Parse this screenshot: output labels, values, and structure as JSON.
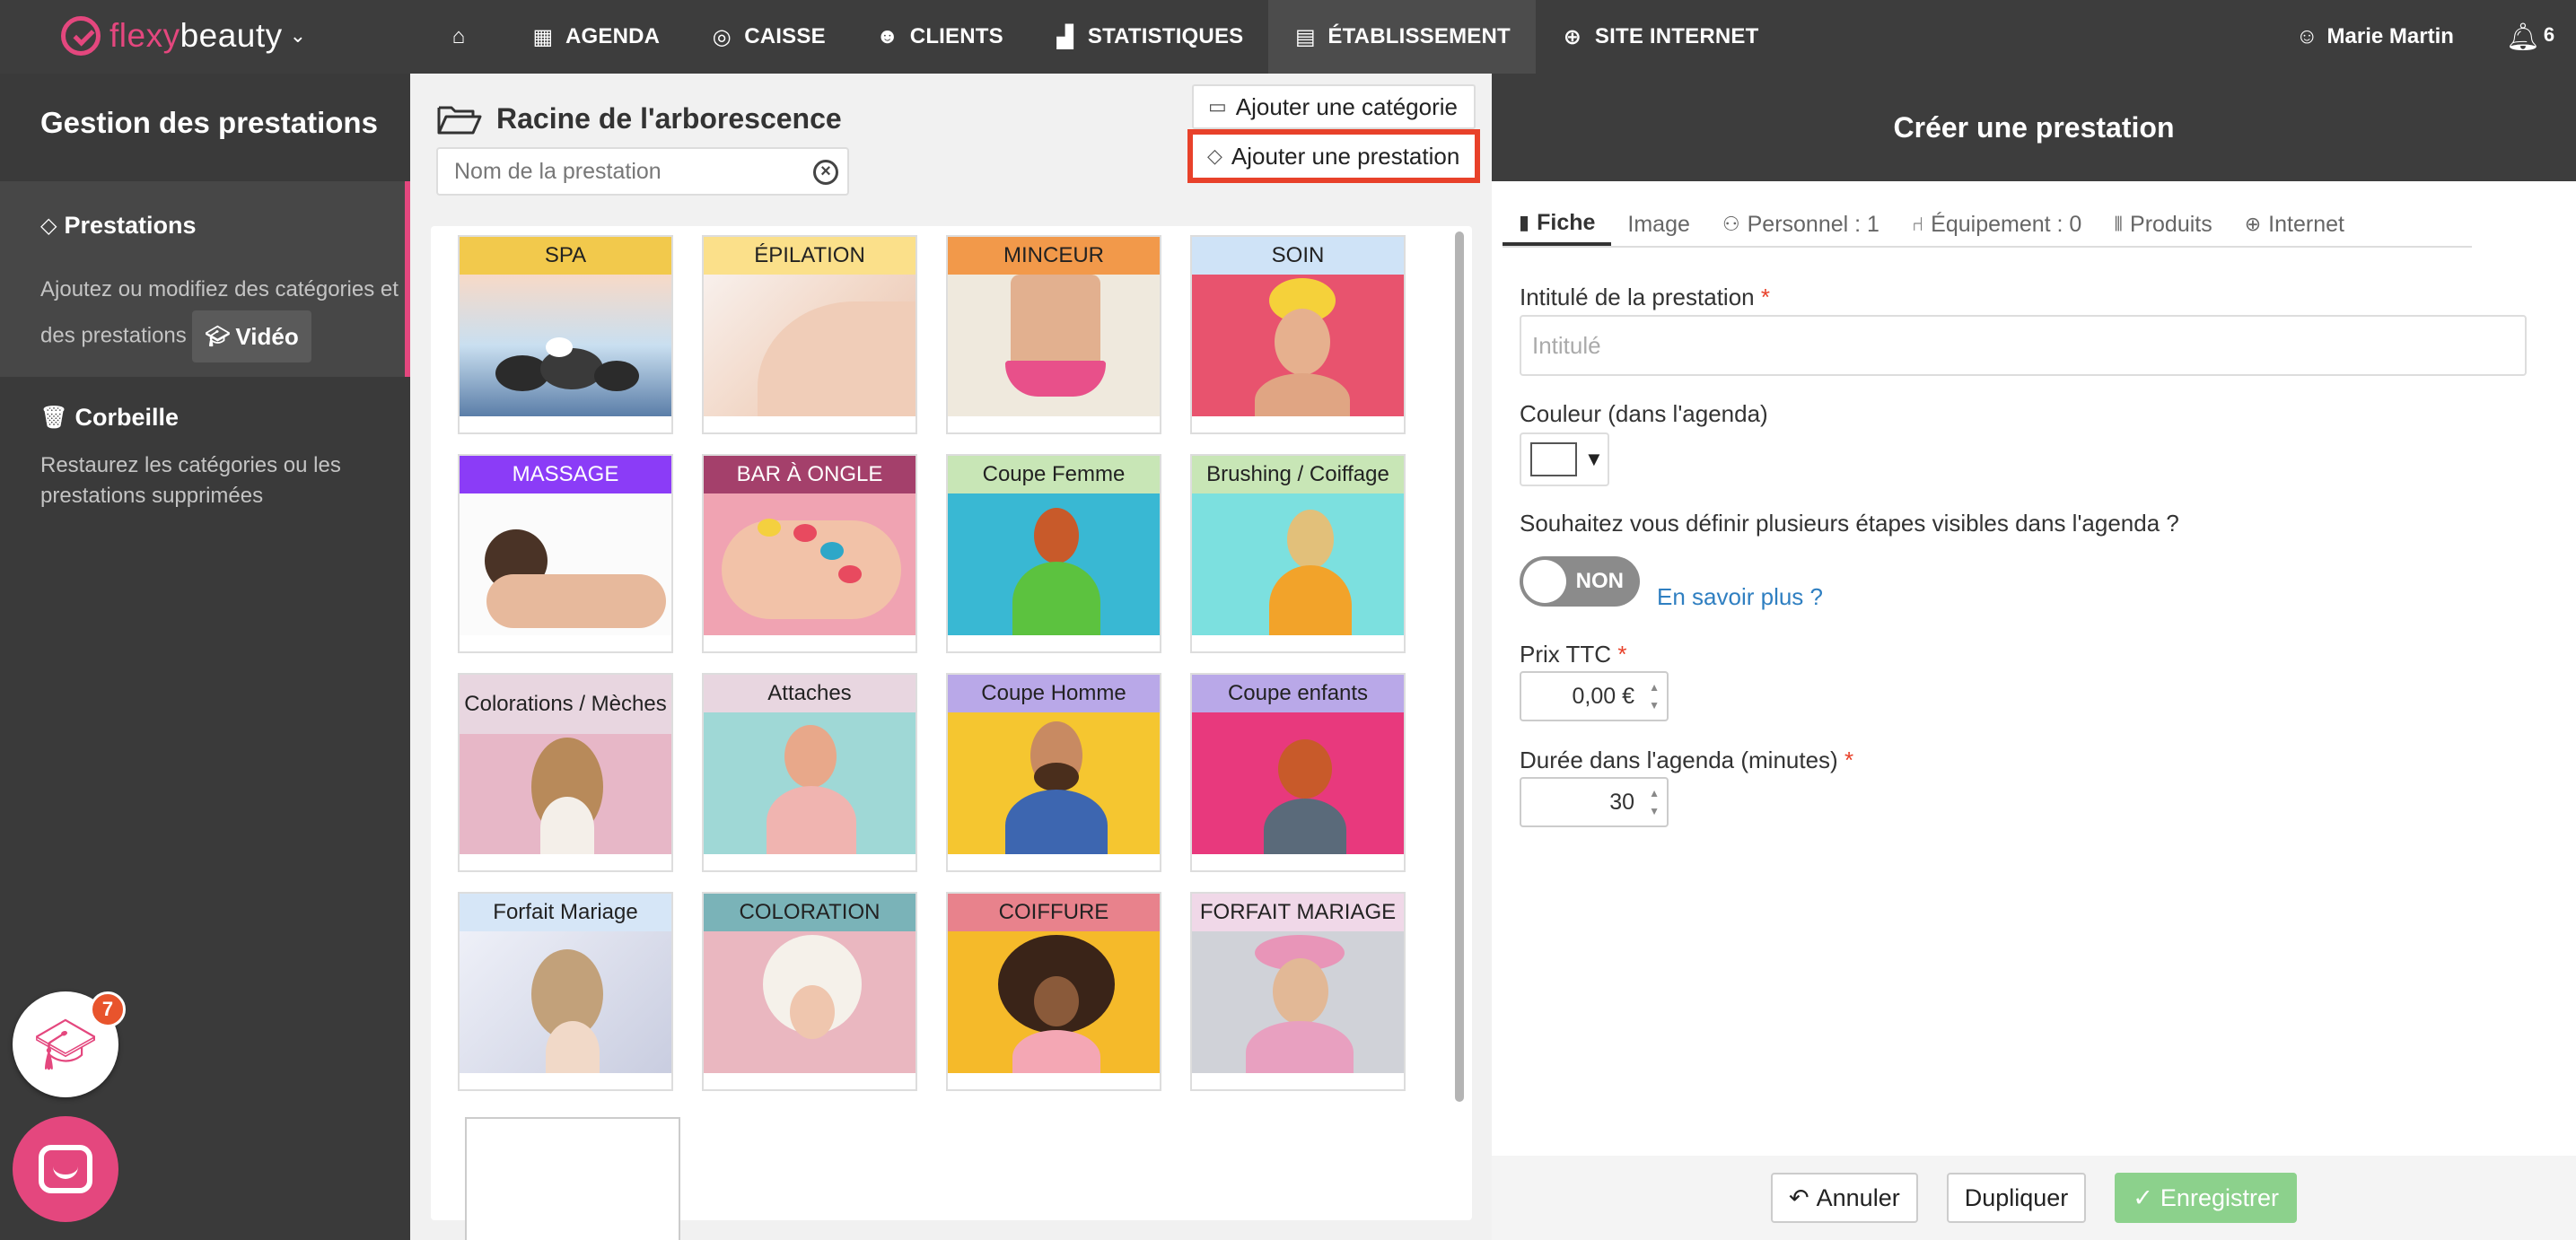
{
  "app": {
    "logo_part1": "flexy",
    "logo_part2": "beauty",
    "nav": [
      {
        "label": "",
        "icon": "home-icon"
      },
      {
        "label": "AGENDA",
        "icon": "calendar-icon"
      },
      {
        "label": "CAISSE",
        "icon": "coins-icon"
      },
      {
        "label": "CLIENTS",
        "icon": "users-icon"
      },
      {
        "label": "STATISTIQUES",
        "icon": "chart-icon"
      },
      {
        "label": "ÉTABLISSEMENT",
        "icon": "store-icon"
      },
      {
        "label": "SITE INTERNET",
        "icon": "globe-icon"
      }
    ],
    "user_name": "Marie Martin",
    "notification_count": "6"
  },
  "sidebar": {
    "title": "Gestion des prestations",
    "prestations_title": "Prestations",
    "prestations_desc": "Ajoutez ou modifiez des catégories et des prestations",
    "video_label": "Vidéo",
    "trash_title": "Corbeille",
    "trash_desc": "Restaurez les catégories ou les prestations supprimées",
    "learn_badge": "7"
  },
  "center": {
    "title": "Racine de l'arborescence",
    "search_placeholder": "Nom de la prestation",
    "add_category": "Ajouter une catégorie",
    "add_service": "Ajouter une prestation",
    "categories": [
      {
        "label": "SPA",
        "color": "#f2c94c"
      },
      {
        "label": "ÉPILATION",
        "color": "#fbe08a"
      },
      {
        "label": "MINCEUR",
        "color": "#f2994a"
      },
      {
        "label": "SOIN",
        "color": "#cfe3f7"
      },
      {
        "label": "MASSAGE",
        "color": "#8b3cf7"
      },
      {
        "label": "BAR À ONGLE",
        "color": "#a4406b"
      },
      {
        "label": "Coupe Femme",
        "color": "#c8e6b6"
      },
      {
        "label": "Brushing / Coiffage",
        "color": "#c8e6b6"
      },
      {
        "label": "Colorations / Mèches",
        "color": "#e8d6e0"
      },
      {
        "label": "Attaches",
        "color": "#e8d6e0"
      },
      {
        "label": "Coupe Homme",
        "color": "#b9a8e8"
      },
      {
        "label": "Coupe enfants",
        "color": "#b9a8e8"
      },
      {
        "label": "Forfait Mariage",
        "color": "#d6e6f7"
      },
      {
        "label": "COLORATION",
        "color": "#7ab3b8"
      },
      {
        "label": "COIFFURE",
        "color": "#e8828c"
      },
      {
        "label": "FORFAIT MARIAGE",
        "color": "#f0d8e8"
      }
    ]
  },
  "form": {
    "header": "Créer une prestation",
    "tabs": [
      {
        "label": "Fiche",
        "icon": "file-icon"
      },
      {
        "label": "Image",
        "icon": ""
      },
      {
        "label": "Personnel : 1",
        "icon": "users-icon"
      },
      {
        "label": "Équipement : 0",
        "icon": "chair-icon"
      },
      {
        "label": "Produits",
        "icon": "barcode-icon"
      },
      {
        "label": "Internet",
        "icon": "globe-icon"
      }
    ],
    "title_label": "Intitulé de la prestation",
    "title_placeholder": "Intitulé",
    "color_label": "Couleur (dans l'agenda)",
    "steps_question": "Souhaitez vous définir plusieurs étapes visibles dans l'agenda ?",
    "toggle_value": "NON",
    "learn_more": "En savoir plus ?",
    "price_label": "Prix TTC",
    "price_value": "0,00 €",
    "duration_label": "Durée dans l'agenda (minutes)",
    "duration_value": "30",
    "required_mark": "*",
    "cancel": "Annuler",
    "duplicate": "Dupliquer",
    "save": "Enregistrer"
  }
}
